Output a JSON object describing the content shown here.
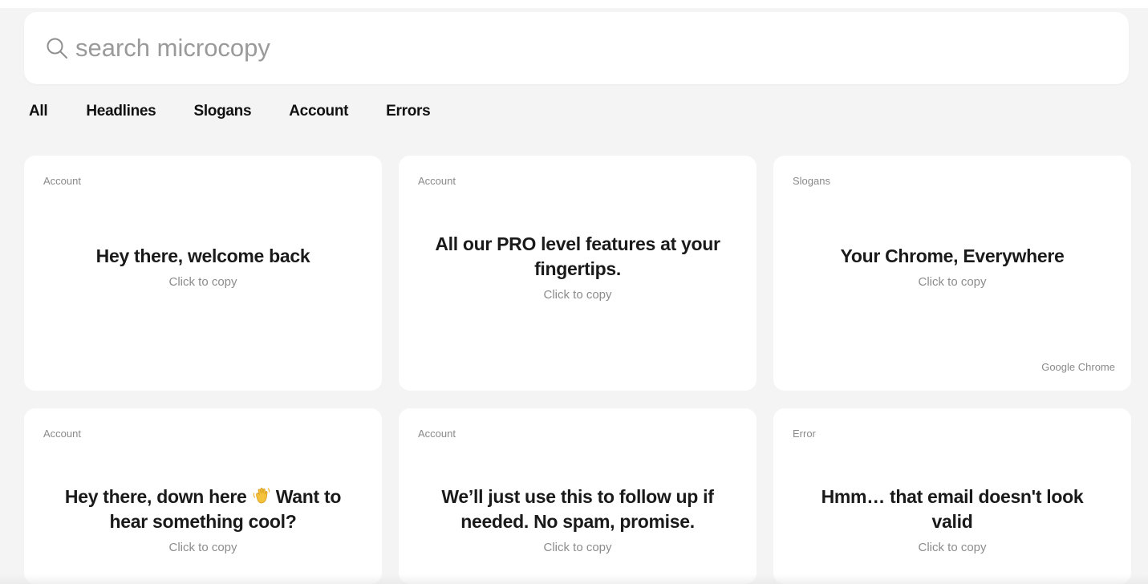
{
  "search": {
    "placeholder": "search microcopy",
    "value": "",
    "icon": "search-icon"
  },
  "tabs": [
    {
      "label": "All"
    },
    {
      "label": "Headlines"
    },
    {
      "label": "Slogans"
    },
    {
      "label": "Account"
    },
    {
      "label": "Errors"
    }
  ],
  "cards": [
    {
      "category": "Account",
      "headline": "Hey there, welcome back",
      "hint": "Click to copy",
      "source": ""
    },
    {
      "category": "Account",
      "headline": "All our PRO level features at your fingertips.",
      "hint": "Click to copy",
      "source": ""
    },
    {
      "category": "Slogans",
      "headline": "Your Chrome, Everywhere",
      "hint": "Click to copy",
      "source": "Google Chrome"
    },
    {
      "category": "Account",
      "headline_pre": "Hey there, down here",
      "headline_emoji": "waving-hand-emoji",
      "headline_post": "Want to hear something cool?",
      "hint": "Click to copy"
    },
    {
      "category": "Account",
      "headline": "We’ll just use this to follow up if needed. No spam, promise.",
      "hint": "Click to copy"
    },
    {
      "category": "Error",
      "headline": "Hmm… that email doesn't look valid",
      "hint": "Click to copy"
    }
  ],
  "colors": {
    "background": "#f4f4f4",
    "card": "#ffffff",
    "text": "#1a1a1a",
    "muted": "#8c8c8c"
  }
}
